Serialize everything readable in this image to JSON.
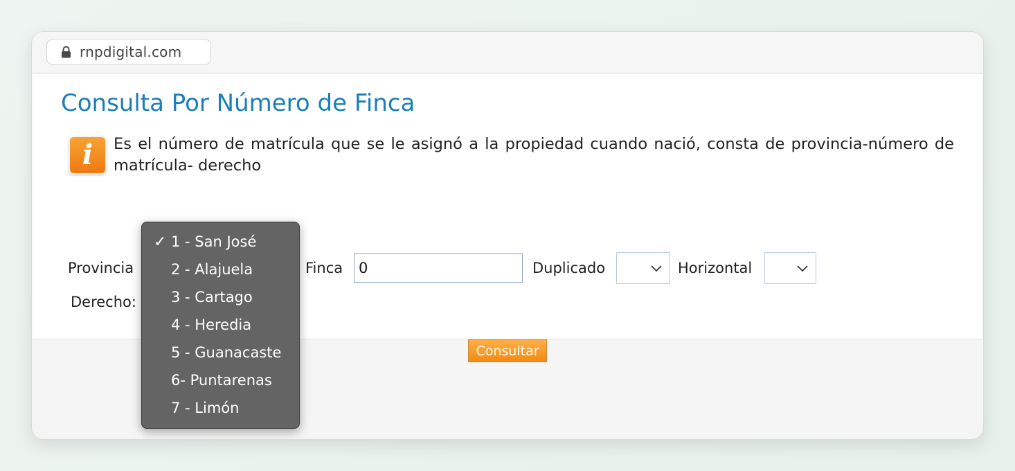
{
  "browser": {
    "url": "rnpdigital.com"
  },
  "page": {
    "title": "Consulta Por Número de Finca",
    "info_text": "Es el número de matrícula que se le asignó a la propiedad cuando nació, consta de provincia-número de matrícula- derecho"
  },
  "form": {
    "provincia_label": "Provincia",
    "finca_label": "Finca",
    "finca_value": "0",
    "duplicado_label": "Duplicado",
    "horizontal_label": "Horizontal",
    "derecho_label": "Derecho:",
    "submit_label": "Consultar"
  },
  "provincia_dropdown": {
    "check_mark": "✓",
    "options": [
      "1 - San José",
      "2 - Alajuela",
      "3 - Cartago",
      "4 - Heredia",
      "5 - Guanacaste",
      "6- Puntarenas",
      "7 - Limón"
    ],
    "selected_index": 0
  },
  "colors": {
    "title": "#1a7fb8",
    "accent_orange": "#f18b12",
    "dropdown_bg": "#646464"
  },
  "icons": {
    "lock": "lock-icon",
    "info": "info-icon",
    "chevron": "chevron-down-icon"
  }
}
